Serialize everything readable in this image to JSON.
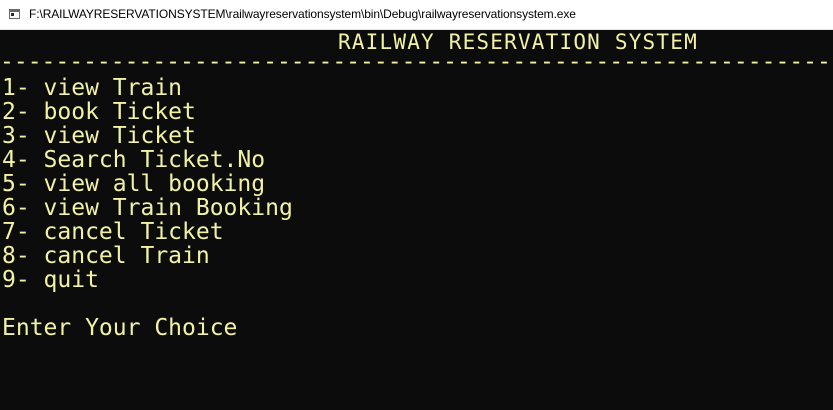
{
  "window": {
    "title": "F:\\RAILWAYRESERVATIONSYSTEM\\railwayreservationsystem\\bin\\Debug\\railwayreservationsystem.exe",
    "icon": "console-app-icon"
  },
  "console": {
    "heading": "RAILWAY RESERVATION SYSTEM",
    "rule": "--------------------------------------------------------------------------------",
    "menu": [
      "1- view Train",
      "2- book Ticket",
      "3- view Ticket",
      "4- Search Ticket.No",
      "5- view all booking",
      "6- view Train Booking",
      "7- cancel Ticket",
      "8- cancel Train",
      "9- quit"
    ],
    "prompt": "Enter Your Choice"
  },
  "colors": {
    "background": "#0c0c0c",
    "text": "#f2f2a5",
    "titlebar": "#ffffff"
  }
}
